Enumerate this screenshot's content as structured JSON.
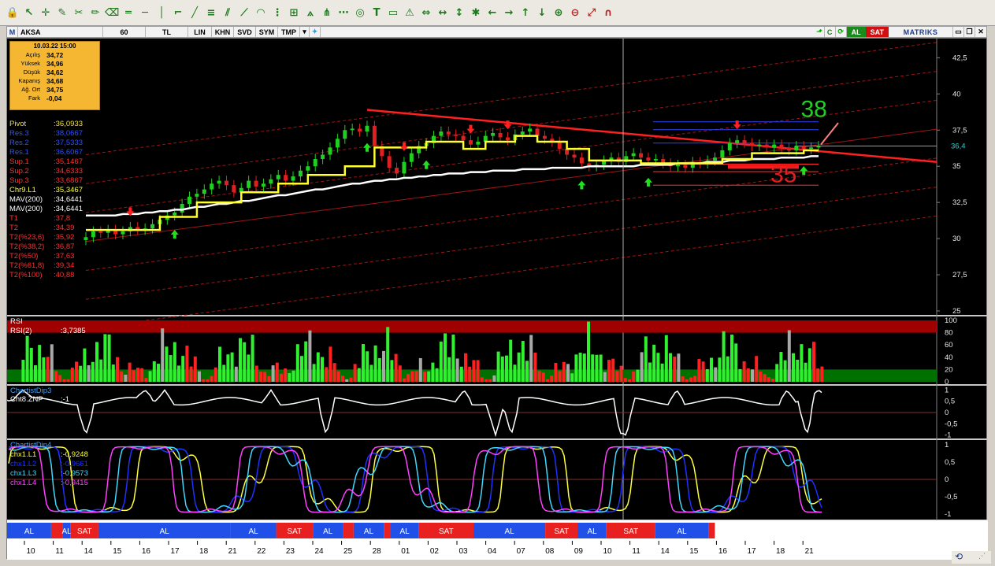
{
  "toolbar": {
    "icons": [
      "lock-icon",
      "cursor-icon",
      "crosshair-icon",
      "edit-icon",
      "tools-icon",
      "pencil-icon",
      "eraser-icon",
      "equal-icon",
      "horizontal-line-icon",
      "vertical-line-icon",
      "bracket-icon",
      "trend-icon",
      "channel-icon",
      "fibonacci-icon",
      "fib-fan-icon",
      "fib-arc-icon",
      "fib-time-icon",
      "gann-icon",
      "gann-fan-icon",
      "pitchfork-icon",
      "regression-icon",
      "cycle-icon",
      "text-icon",
      "note-icon",
      "alert-icon",
      "arrow-both-icon",
      "arrow-h-icon",
      "arrow-v-icon",
      "star-icon",
      "left-icon",
      "right-icon",
      "up-icon",
      "down-icon",
      "zoom-in-icon",
      "zoom-out-icon",
      "resize-icon",
      "magnet-icon"
    ]
  },
  "symbar": {
    "logo": "M",
    "symbol": "AKSA",
    "period": "60",
    "currency": "TL",
    "scale": "LIN",
    "khn": "KHN",
    "svd": "SVD",
    "sym": "SYM",
    "tmp": "TMP",
    "c_label": "C",
    "buy": "AL",
    "sell": "SAT",
    "brand": "MATRIKS",
    "colors": {
      "buy": "#1a8a1a",
      "sell": "#d01010",
      "brand": "#1a3b8a"
    }
  },
  "infobox": {
    "datetime": "10.03.22 15:00",
    "rows": [
      {
        "label": "Açılış",
        "value": "34,72"
      },
      {
        "label": "Yüksek",
        "value": "34,96"
      },
      {
        "label": "Düşük",
        "value": "34,62"
      },
      {
        "label": "Kapanış",
        "value": "34,68"
      },
      {
        "label": "Ağ. Ort",
        "value": "34,75"
      },
      {
        "label": "Fark",
        "value": "-0,04"
      }
    ]
  },
  "indicators": [
    {
      "label": "Pivot",
      "value": ":36,0933",
      "color": "#f0e040"
    },
    {
      "label": "Res.3",
      "value": ":38,0667",
      "color": "#3050ff"
    },
    {
      "label": "Res.2",
      "value": ":37,5333",
      "color": "#3050ff"
    },
    {
      "label": "Res.1",
      "value": ":36,6067",
      "color": "#3050ff"
    },
    {
      "label": "Sup.1",
      "value": ":35,1467",
      "color": "#ff3030"
    },
    {
      "label": "Sup.2",
      "value": ":34,6333",
      "color": "#ff3030"
    },
    {
      "label": "Sup.3",
      "value": ":33,6867",
      "color": "#ff3030"
    },
    {
      "label": "Chr9.L1",
      "value": ":35,3467",
      "color": "#ffff40"
    },
    {
      "label": "MAV(200)",
      "value": ":34,6441",
      "color": "#ffffff"
    },
    {
      "label": "MAV(200)",
      "value": ":34,6441",
      "color": "#ffffff"
    },
    {
      "label": "T1",
      "value": ":37,8",
      "color": "#ff3030"
    },
    {
      "label": "T2",
      "value": ":34,39",
      "color": "#ff3030"
    },
    {
      "label": "T2(%23,6)",
      "value": ":35,92",
      "color": "#ff3030"
    },
    {
      "label": "T2(%38,2)",
      "value": ":36,87",
      "color": "#ff3030"
    },
    {
      "label": "T2(%50)",
      "value": ":37,63",
      "color": "#ff3030"
    },
    {
      "label": "T2(%61,8)",
      "value": ":39,34",
      "color": "#ff3030"
    },
    {
      "label": "T2(%100)",
      "value": ":40,88",
      "color": "#ff3030"
    }
  ],
  "chart_data": [
    {
      "type": "line",
      "panel": "price",
      "ylim": [
        25,
        43.5
      ],
      "yticks": [
        "42,5",
        "40",
        "37,5",
        "35",
        "32,5",
        "30",
        "27,5",
        "25"
      ],
      "ytick_values": [
        42.5,
        40,
        37.5,
        35,
        32.5,
        30,
        27.5,
        25
      ],
      "last_price": "36,4",
      "last_price_value": 36.4,
      "annotations": [
        {
          "text": "38",
          "color": "#20d020",
          "x": 0.825,
          "y": 38.4
        },
        {
          "text": "35",
          "color": "#e02020",
          "x": 0.79,
          "y": 33.9
        }
      ],
      "close": [
        30.1,
        30.5,
        30.4,
        30.6,
        30.3,
        30.5,
        30.8,
        30.6,
        30.7,
        31.0,
        31.3,
        31.6,
        31.8,
        32.4,
        32.9,
        33.1,
        33.4,
        33.8,
        34.0,
        33.7,
        33.2,
        33.5,
        34.0,
        33.6,
        33.8,
        34.1,
        34.4,
        34.0,
        34.3,
        34.7,
        35.0,
        35.5,
        35.8,
        36.3,
        36.9,
        37.5,
        37.6,
        37.4,
        37.8,
        36.4,
        35.7,
        34.9,
        34.5,
        35.3,
        35.9,
        36.4,
        36.6,
        37.1,
        37.4,
        37.2,
        37.1,
        36.8,
        36.5,
        36.7,
        37.1,
        37.3,
        37.0,
        36.8,
        37.2,
        37.4,
        37.6,
        37.1,
        36.9,
        36.7,
        36.2,
        35.8,
        35.6,
        35.2,
        35.0,
        35.1,
        35.4,
        35.6,
        35.3,
        35.7,
        35.9,
        35.6,
        35.4,
        35.5,
        35.2,
        35.0,
        35.1,
        34.9,
        35.3,
        35.2,
        35.4,
        35.6,
        36.1,
        36.6,
        36.8,
        36.6,
        36.4,
        36.5,
        36.3,
        36.5,
        36.3,
        36.1,
        36.4,
        36.2,
        36.3,
        36.4
      ],
      "signal_line": [
        30.6,
        30.6,
        30.6,
        30.6,
        30.6,
        30.6,
        30.6,
        30.6,
        30.6,
        30.6,
        31.5,
        31.5,
        31.5,
        31.5,
        31.5,
        32.5,
        32.5,
        32.5,
        32.5,
        32.5,
        32.5,
        33.2,
        33.2,
        33.2,
        33.2,
        33.2,
        33.8,
        33.8,
        33.8,
        33.8,
        34.4,
        34.4,
        34.4,
        34.4,
        34.4,
        35.0,
        35.0,
        35.0,
        35.0,
        36.3,
        36.3,
        36.3,
        36.3,
        36.3,
        36.3,
        36.3,
        36.7,
        36.7,
        36.7,
        36.7,
        36.7,
        36.2,
        36.2,
        36.2,
        36.7,
        36.7,
        36.7,
        36.7,
        37.1,
        37.1,
        37.1,
        36.7,
        36.7,
        36.7,
        36.7,
        36.2,
        36.2,
        36.2,
        35.4,
        35.4,
        35.4,
        35.4,
        35.4,
        35.4,
        35.4,
        35.2,
        35.2,
        35.2,
        35.2,
        35.2,
        35.2,
        35.2,
        35.2,
        35.2,
        35.2,
        35.2,
        35.5,
        35.5,
        35.5,
        35.5,
        35.9,
        35.9,
        35.9,
        35.9,
        35.9,
        35.9,
        35.9,
        36.1,
        36.1,
        36.1
      ],
      "mav200": [
        31.6,
        31.6,
        31.6,
        31.6,
        31.6,
        31.7,
        31.7,
        31.7,
        31.8,
        31.8,
        31.9,
        31.9,
        32.0,
        32.0,
        32.1,
        32.2,
        32.2,
        32.3,
        32.4,
        32.4,
        32.5,
        32.6,
        32.6,
        32.7,
        32.8,
        32.9,
        33.0,
        33.0,
        33.1,
        33.2,
        33.3,
        33.4,
        33.4,
        33.5,
        33.6,
        33.7,
        33.8,
        33.8,
        33.9,
        34.0,
        34.0,
        34.1,
        34.1,
        34.2,
        34.2,
        34.3,
        34.3,
        34.4,
        34.4,
        34.5,
        34.5,
        34.5,
        34.6,
        34.6,
        34.6,
        34.7,
        34.7,
        34.7,
        34.7,
        34.8,
        34.8,
        34.8,
        34.8,
        34.9,
        34.9,
        34.9,
        34.9,
        34.9,
        35.0,
        35.0,
        35.0,
        35.0,
        35.0,
        35.0,
        35.0,
        35.1,
        35.1,
        35.1,
        35.1,
        35.1,
        35.2,
        35.2,
        35.2,
        35.2,
        35.3,
        35.3,
        35.3,
        35.4,
        35.4,
        35.4,
        35.5,
        35.5,
        35.5,
        35.5,
        35.6,
        35.6,
        35.6,
        35.6,
        35.7,
        35.7
      ]
    },
    {
      "type": "bar",
      "panel": "rsi",
      "title": "RSI",
      "series_label": "RSI(2)",
      "value": ":3,7385",
      "yticks": [
        "100",
        "80",
        "60",
        "40",
        "20",
        "0"
      ],
      "ytick_values": [
        100,
        80,
        60,
        40,
        20,
        0
      ],
      "ylim": [
        0,
        100
      ]
    },
    {
      "type": "line",
      "panel": "chartistdip3",
      "title": "ChartistDip3",
      "series_label": "Cht8.ZNP",
      "value": ":-1",
      "yticks": [
        "1",
        "0,5",
        "0",
        "-0,5",
        "-1"
      ],
      "ytick_values": [
        1,
        0.5,
        0,
        -0.5,
        -1
      ],
      "ylim": [
        -1.05,
        1.05
      ]
    },
    {
      "type": "line",
      "panel": "chartistdip4",
      "title": "ChartistDip4",
      "series": [
        {
          "name": "chx1.L1",
          "value": ":-0,9248",
          "color": "#ffff40"
        },
        {
          "name": "chx1.L2",
          "value": ":-0,9661",
          "color": "#2030ff"
        },
        {
          "name": "chx1.L3",
          "value": ":-0,9573",
          "color": "#40d8ff"
        },
        {
          "name": "chx1.L4",
          "value": ":-0,9415",
          "color": "#ff40ff"
        }
      ],
      "yticks": [
        "1",
        "0,5",
        "0",
        "-0,5",
        "-1"
      ],
      "ytick_values": [
        1,
        0.5,
        0,
        -0.5,
        -1
      ],
      "ylim": [
        -1.05,
        1.05
      ]
    }
  ],
  "signals": [
    {
      "label": "AL",
      "type": "buy",
      "start": 0.0,
      "end": 0.054
    },
    {
      "label": "",
      "type": "sell",
      "start": 0.054,
      "end": 0.068
    },
    {
      "label": "AL",
      "type": "buy",
      "start": 0.068,
      "end": 0.078
    },
    {
      "label": "SAT",
      "type": "sell",
      "start": 0.078,
      "end": 0.112
    },
    {
      "label": "AL",
      "type": "buy",
      "start": 0.112,
      "end": 0.274
    },
    {
      "label": "AL",
      "type": "buy",
      "start": 0.274,
      "end": 0.33
    },
    {
      "label": "SAT",
      "type": "sell",
      "start": 0.33,
      "end": 0.375
    },
    {
      "label": "AL",
      "type": "buy",
      "start": 0.375,
      "end": 0.412
    },
    {
      "label": "",
      "type": "sell",
      "start": 0.412,
      "end": 0.425
    },
    {
      "label": "AL",
      "type": "buy",
      "start": 0.425,
      "end": 0.462
    },
    {
      "label": "",
      "type": "sell",
      "start": 0.462,
      "end": 0.47
    },
    {
      "label": "AL",
      "type": "buy",
      "start": 0.47,
      "end": 0.505
    },
    {
      "label": "SAT",
      "type": "sell",
      "start": 0.505,
      "end": 0.572
    },
    {
      "label": "AL",
      "type": "buy",
      "start": 0.572,
      "end": 0.66
    },
    {
      "label": "SAT",
      "type": "sell",
      "start": 0.66,
      "end": 0.7
    },
    {
      "label": "AL",
      "type": "buy",
      "start": 0.7,
      "end": 0.735
    },
    {
      "label": "SAT",
      "type": "sell",
      "start": 0.735,
      "end": 0.795
    },
    {
      "label": "AL",
      "type": "buy",
      "start": 0.795,
      "end": 0.86
    },
    {
      "label": "",
      "type": "sell",
      "start": 0.86,
      "end": 0.868
    }
  ],
  "dates": [
    "10",
    "11",
    "14",
    "15",
    "16",
    "17",
    "18",
    "21",
    "22",
    "23",
    "24",
    "25",
    "28",
    "01",
    "02",
    "03",
    "04",
    "07",
    "08",
    "09",
    "10",
    "11",
    "14",
    "15",
    "16",
    "17",
    "18",
    "21"
  ]
}
